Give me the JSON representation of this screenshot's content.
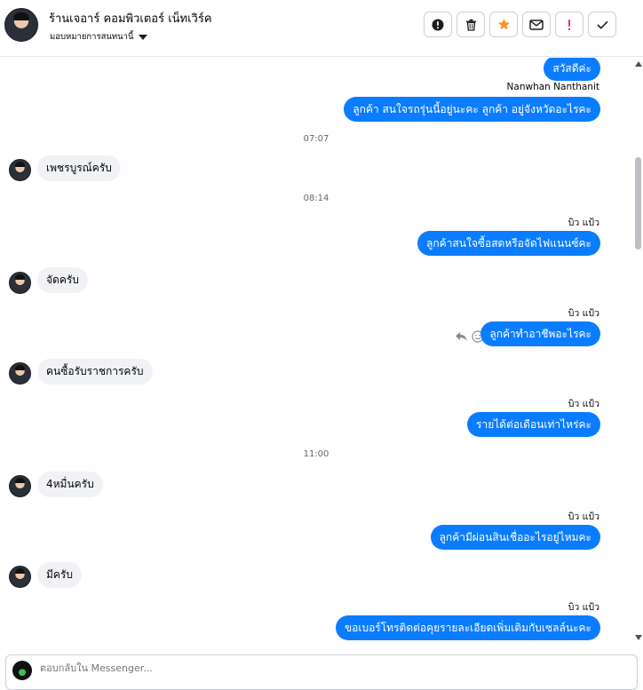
{
  "header": {
    "page_name": "ร้านเจอาร์ คอมพิวเตอร์ เน็ทเวิร์ค",
    "assign_label": "มอบหมายการสนทนานี้"
  },
  "toolbar": {
    "actions": [
      {
        "icon": "exclamation-circle-icon",
        "label": "Mark as spam"
      },
      {
        "icon": "trash-icon",
        "label": "Delete"
      },
      {
        "icon": "star-icon",
        "label": "Star",
        "color": "#f7931e"
      },
      {
        "icon": "envelope-icon",
        "label": "Mark as unread"
      },
      {
        "icon": "exclamation-icon",
        "label": "Follow up",
        "color": "#e41e3f"
      },
      {
        "icon": "checkmark-icon",
        "label": "Mark as done"
      }
    ]
  },
  "messages": [
    {
      "type": "out",
      "text": "สวัสดีค่ะ"
    },
    {
      "type": "sender",
      "text": "Nanwhan Nanthanit"
    },
    {
      "type": "out",
      "text": "ลูกค้า สนใจรถรุ่นนี้อยู่นะคะ  ลูกค้า อยู่จังหวัดอะไรคะ"
    },
    {
      "type": "time",
      "text": "07:07"
    },
    {
      "type": "in",
      "text": "เพชรบูรณ์ครับ"
    },
    {
      "type": "time",
      "text": "08:14"
    },
    {
      "type": "sender",
      "text": "บิว แป้ว"
    },
    {
      "type": "out",
      "text": "ลูกค้าสนใจซื้อสดหรือจัดไฟแนนซ์คะ"
    },
    {
      "type": "in",
      "text": "จัดครับ"
    },
    {
      "type": "sender",
      "text": "บิว แป้ว"
    },
    {
      "type": "out",
      "text": "ลูกค้าทำอาชีพอะไรคะ"
    },
    {
      "type": "in",
      "text": "คนซื้อรับราชการครับ"
    },
    {
      "type": "sender",
      "text": "บิว แป้ว"
    },
    {
      "type": "out",
      "text": "รายได้ต่อเดือนเท่าไหร่คะ"
    },
    {
      "type": "time",
      "text": "11:00"
    },
    {
      "type": "in",
      "text": "4หมื่นครับ"
    },
    {
      "type": "sender",
      "text": "บิว แป้ว"
    },
    {
      "type": "out",
      "text": "ลูกค้ามีผ่อนสินเชื่ออะไรอยู่ไหมคะ"
    },
    {
      "type": "in",
      "text": "มีครับ"
    },
    {
      "type": "sender",
      "text": "บิว แป้ว"
    },
    {
      "type": "out",
      "text": "ขอเบอร์โทรติดต่อคุยรายละเอียดเพิ่มเติมกับเซลล์นะคะ"
    }
  ],
  "composer": {
    "placeholder": "ตอบกลับใน Messenger..."
  },
  "colors": {
    "outgoing_bubble": "#0a7cff",
    "incoming_bubble": "#f0f2f5"
  }
}
